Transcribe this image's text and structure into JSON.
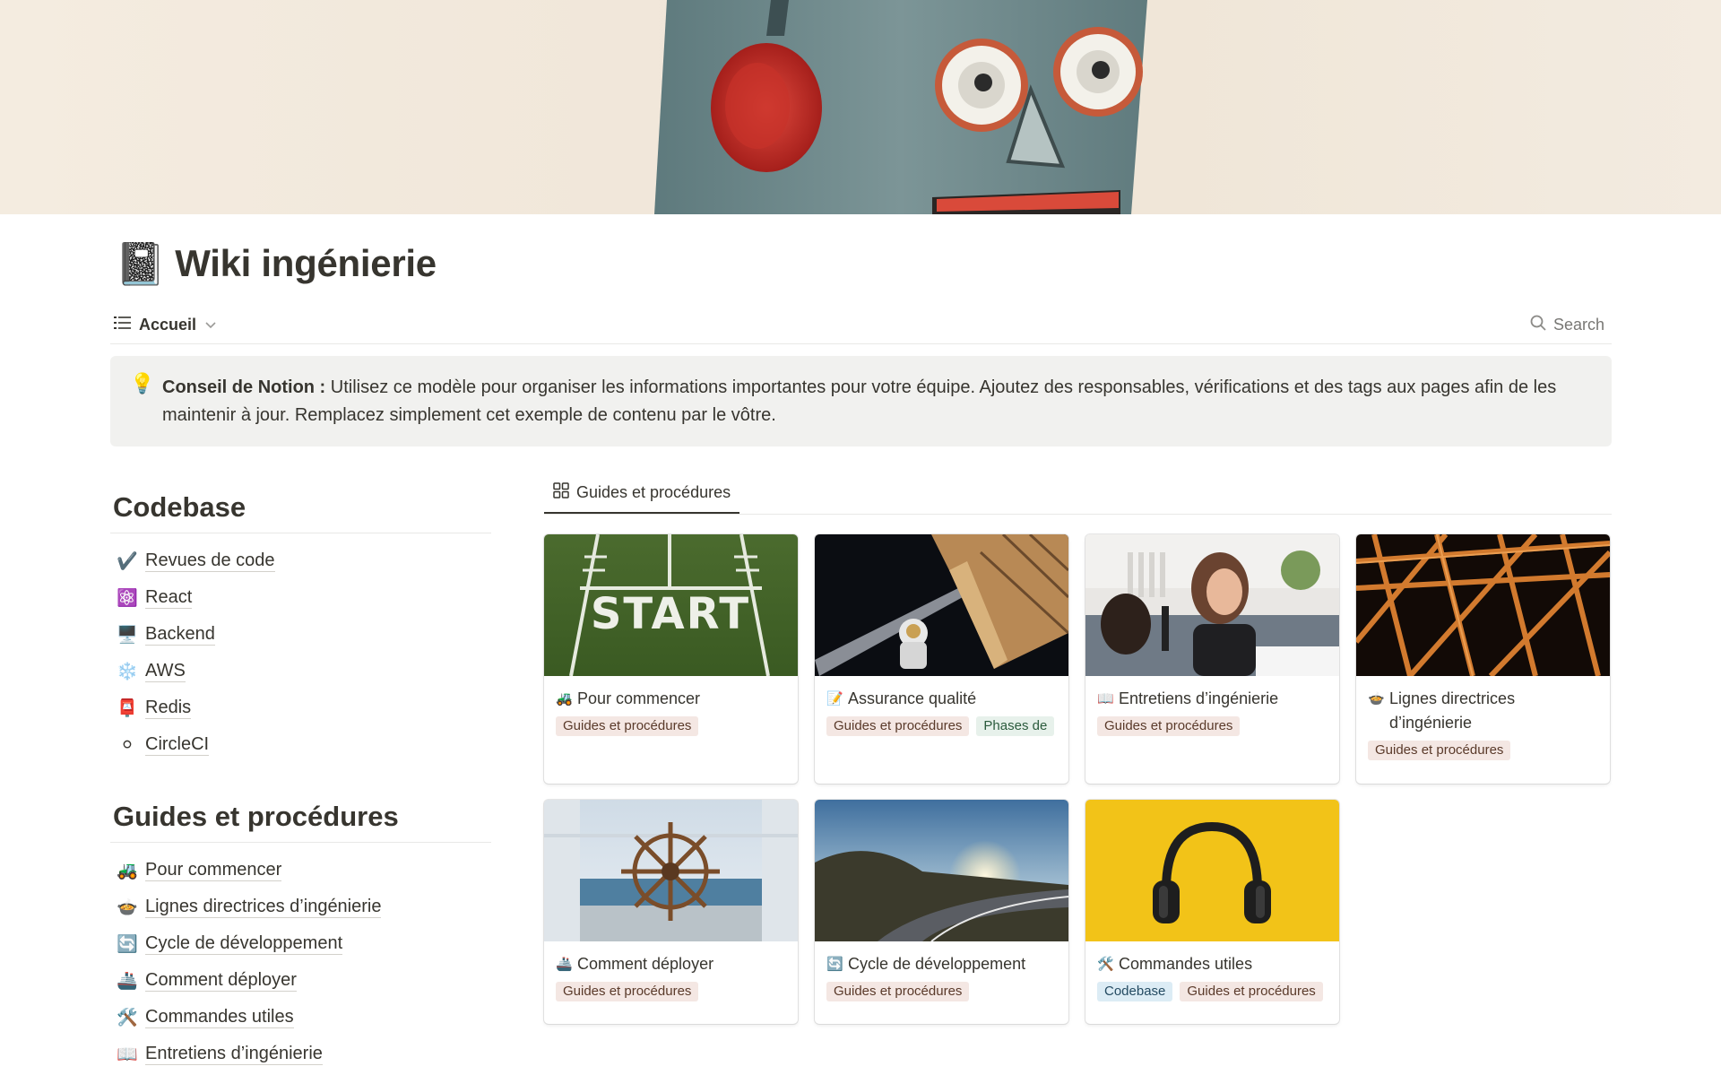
{
  "page": {
    "icon": "📓",
    "title": "Wiki ingénierie"
  },
  "toolbar": {
    "view_icon": "list-icon",
    "view_label": "Accueil",
    "search_label": "Search"
  },
  "callout": {
    "icon": "💡",
    "bold": "Conseil de Notion :",
    "text": " Utilisez ce modèle pour organiser les informations importantes pour votre équipe. Ajoutez des responsables, vérifications et des tags aux pages afin de les maintenir à jour. Remplacez simplement cet exemple de contenu par le vôtre."
  },
  "sections": [
    {
      "heading": "Codebase",
      "items": [
        {
          "icon": "✔️",
          "label": "Revues de code"
        },
        {
          "icon": "⚛️",
          "label": "React"
        },
        {
          "icon": "🖥️",
          "label": "Backend"
        },
        {
          "icon": "❄️",
          "label": "AWS"
        },
        {
          "icon": "📮",
          "label": "Redis"
        },
        {
          "icon": "⚪",
          "label": "CircleCI"
        }
      ]
    },
    {
      "heading": "Guides et procédures",
      "items": [
        {
          "icon": "🚜",
          "label": "Pour commencer"
        },
        {
          "icon": "🍲",
          "label": "Lignes directrices d’ingénierie"
        },
        {
          "icon": "🔄",
          "label": "Cycle de développement"
        },
        {
          "icon": "🚢",
          "label": "Comment déployer"
        },
        {
          "icon": "🛠️",
          "label": "Commandes utiles"
        },
        {
          "icon": "📖",
          "label": "Entretiens d’ingénierie"
        }
      ]
    }
  ],
  "gallery": {
    "tab_label": "Guides et procédures",
    "cards": [
      {
        "icon": "🚜",
        "title": "Pour commencer",
        "image": "start-line",
        "tags": [
          "Guides et procédures"
        ]
      },
      {
        "icon": "📝",
        "title": "Assurance qualité",
        "image": "astronaut",
        "tags": [
          "Guides et procédures",
          "Phases de"
        ]
      },
      {
        "icon": "📖",
        "title": "Entretiens d’ingénierie",
        "image": "interview",
        "tags": [
          "Guides et procédures"
        ]
      },
      {
        "icon": "🍲",
        "title": "Lignes directrices d’ingénierie",
        "image": "bridge",
        "tags": [
          "Guides et procédures"
        ]
      },
      {
        "icon": "🚢",
        "title": "Comment déployer",
        "image": "ship-wheel",
        "tags": [
          "Guides et procédures"
        ]
      },
      {
        "icon": "🔄",
        "title": "Cycle de développement",
        "image": "sunset-road",
        "tags": [
          "Guides et procédures"
        ]
      },
      {
        "icon": "🛠️",
        "title": "Commandes utiles",
        "image": "headphones",
        "tags": [
          "Codebase",
          "Guides et procédures"
        ]
      }
    ]
  }
}
